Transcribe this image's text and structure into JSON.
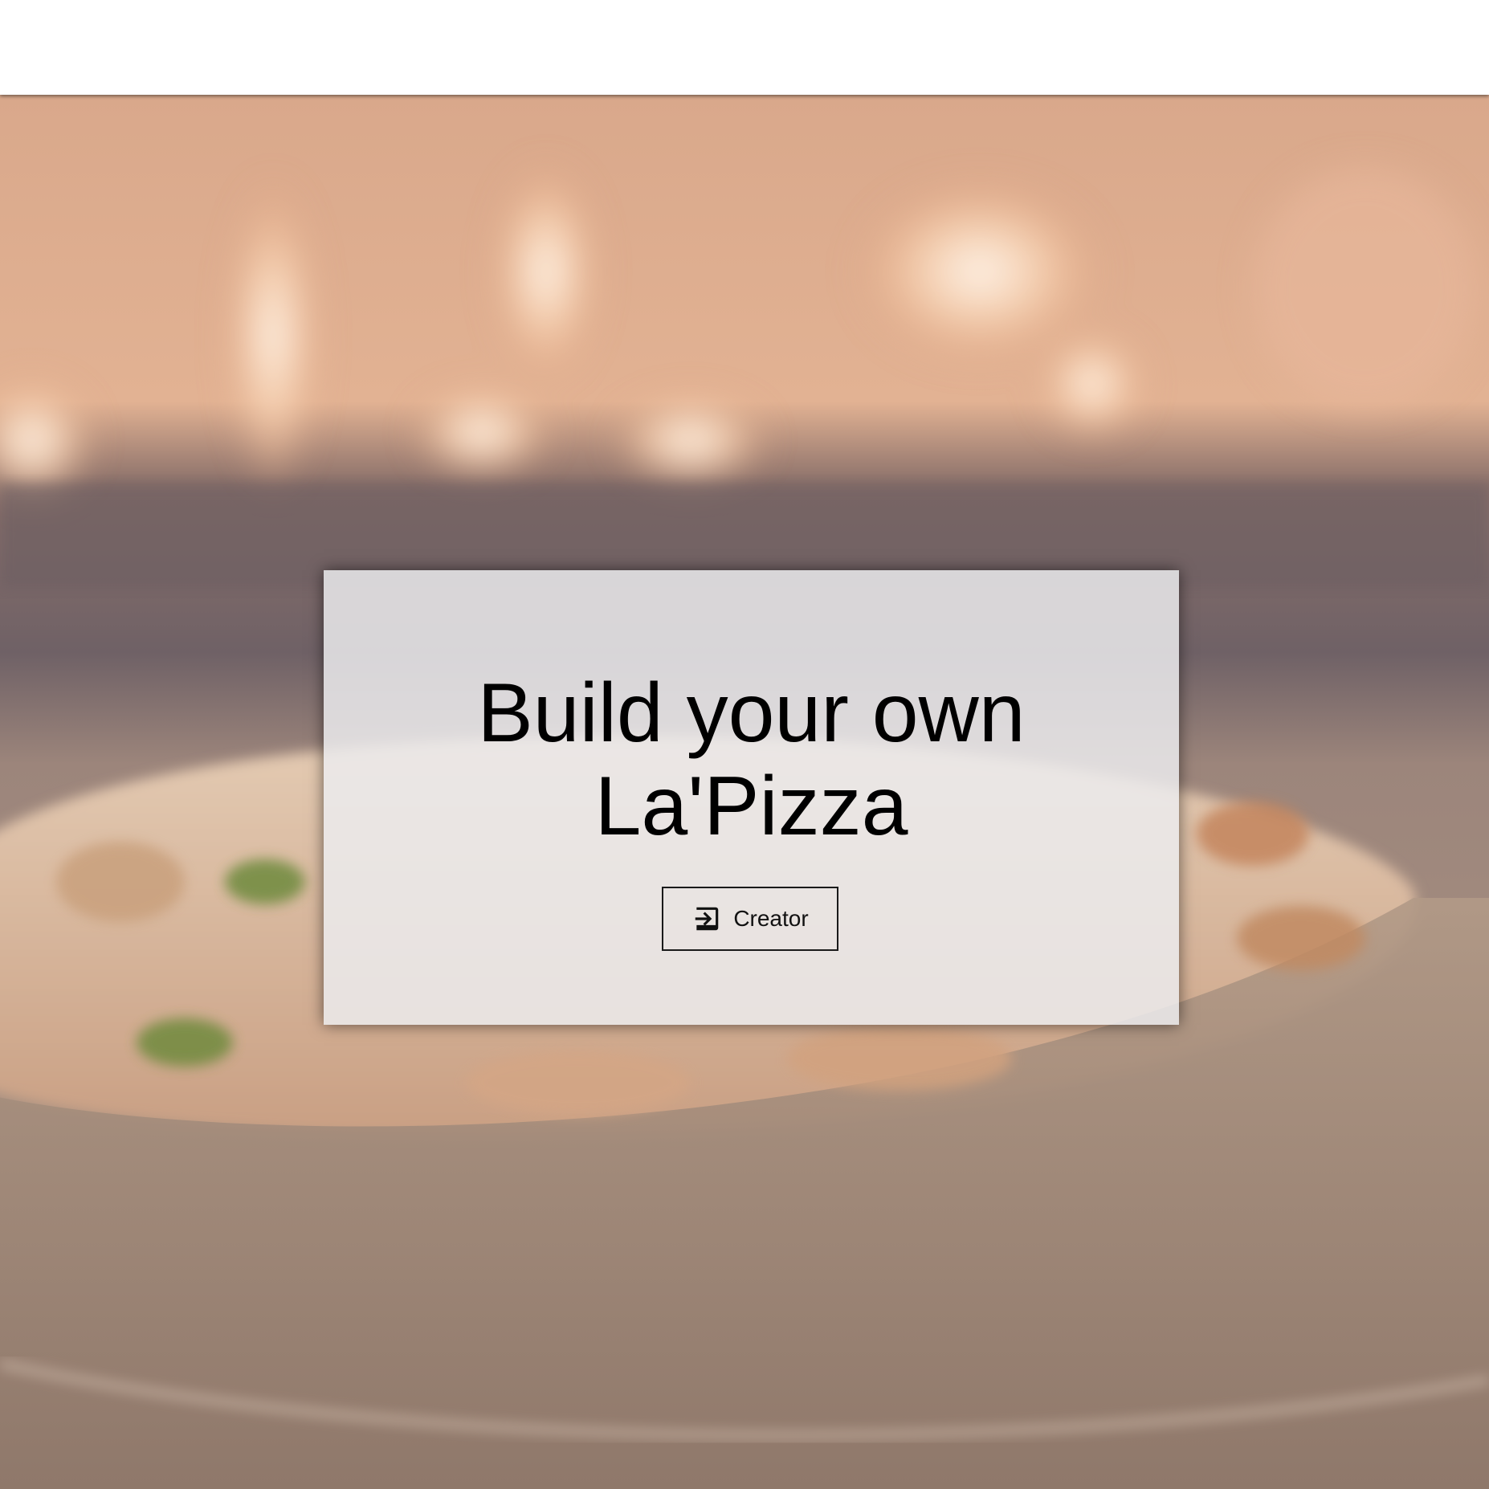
{
  "hero": {
    "background_image": "pizza-oven-photo",
    "title_line1": "Build your own",
    "title_line2": "La'Pizza"
  },
  "actions": {
    "creator_label": "Creator",
    "creator_icon": "login-arrow-icon"
  },
  "colors": {
    "overlay": "#ececee",
    "text": "#000000",
    "button_border": "#1a1a1a"
  }
}
